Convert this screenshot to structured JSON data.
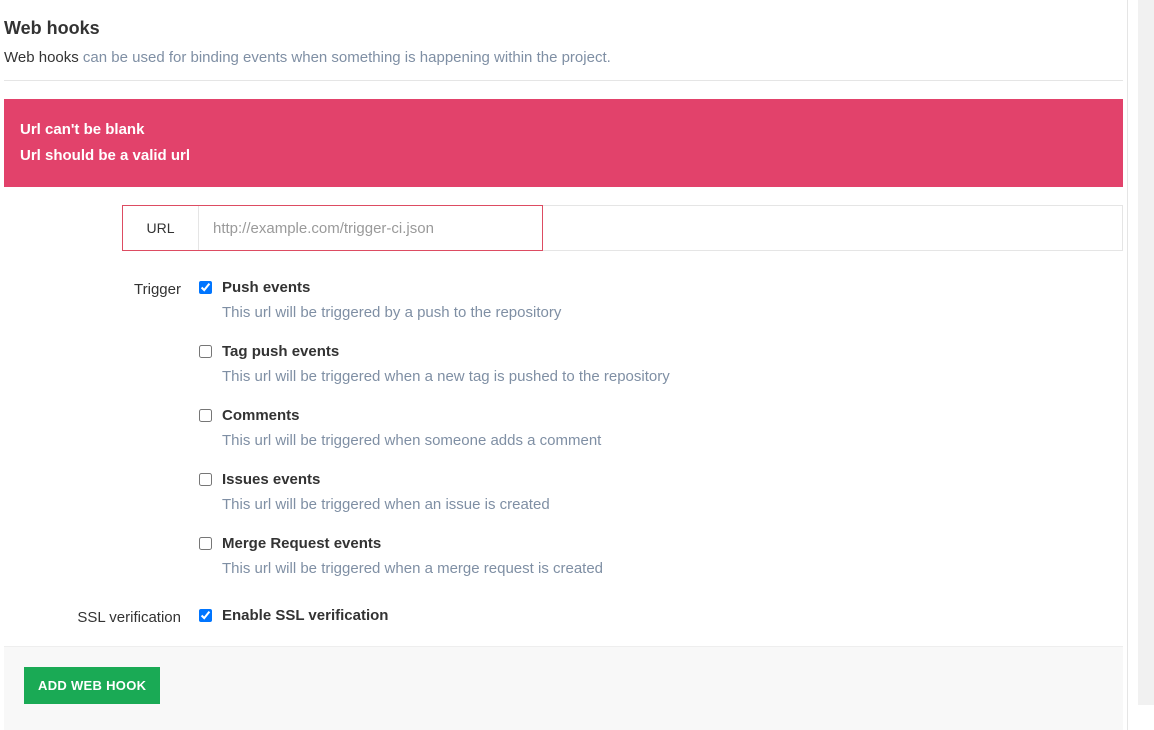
{
  "header": {
    "title": "Web hooks",
    "subtitle_strong": "Web hooks",
    "subtitle_rest": " can be used for binding events when something is happening within the project."
  },
  "alert": {
    "lines": [
      "Url can't be blank",
      "Url should be a valid url"
    ]
  },
  "form": {
    "url_label": "URL",
    "url_placeholder": "http://example.com/trigger-ci.json",
    "url_value": "",
    "trigger_label": "Trigger",
    "ssl_label": "SSL verification",
    "triggers": [
      {
        "title": "Push events",
        "desc": "This url will be triggered by a push to the repository",
        "checked": true
      },
      {
        "title": "Tag push events",
        "desc": "This url will be triggered when a new tag is pushed to the repository",
        "checked": false
      },
      {
        "title": "Comments",
        "desc": "This url will be triggered when someone adds a comment",
        "checked": false
      },
      {
        "title": "Issues events",
        "desc": "This url will be triggered when an issue is created",
        "checked": false
      },
      {
        "title": "Merge Request events",
        "desc": "This url will be triggered when a merge request is created",
        "checked": false
      }
    ],
    "ssl": {
      "title": "Enable SSL verification",
      "checked": true
    }
  },
  "actions": {
    "add_label": "ADD WEB HOOK"
  }
}
